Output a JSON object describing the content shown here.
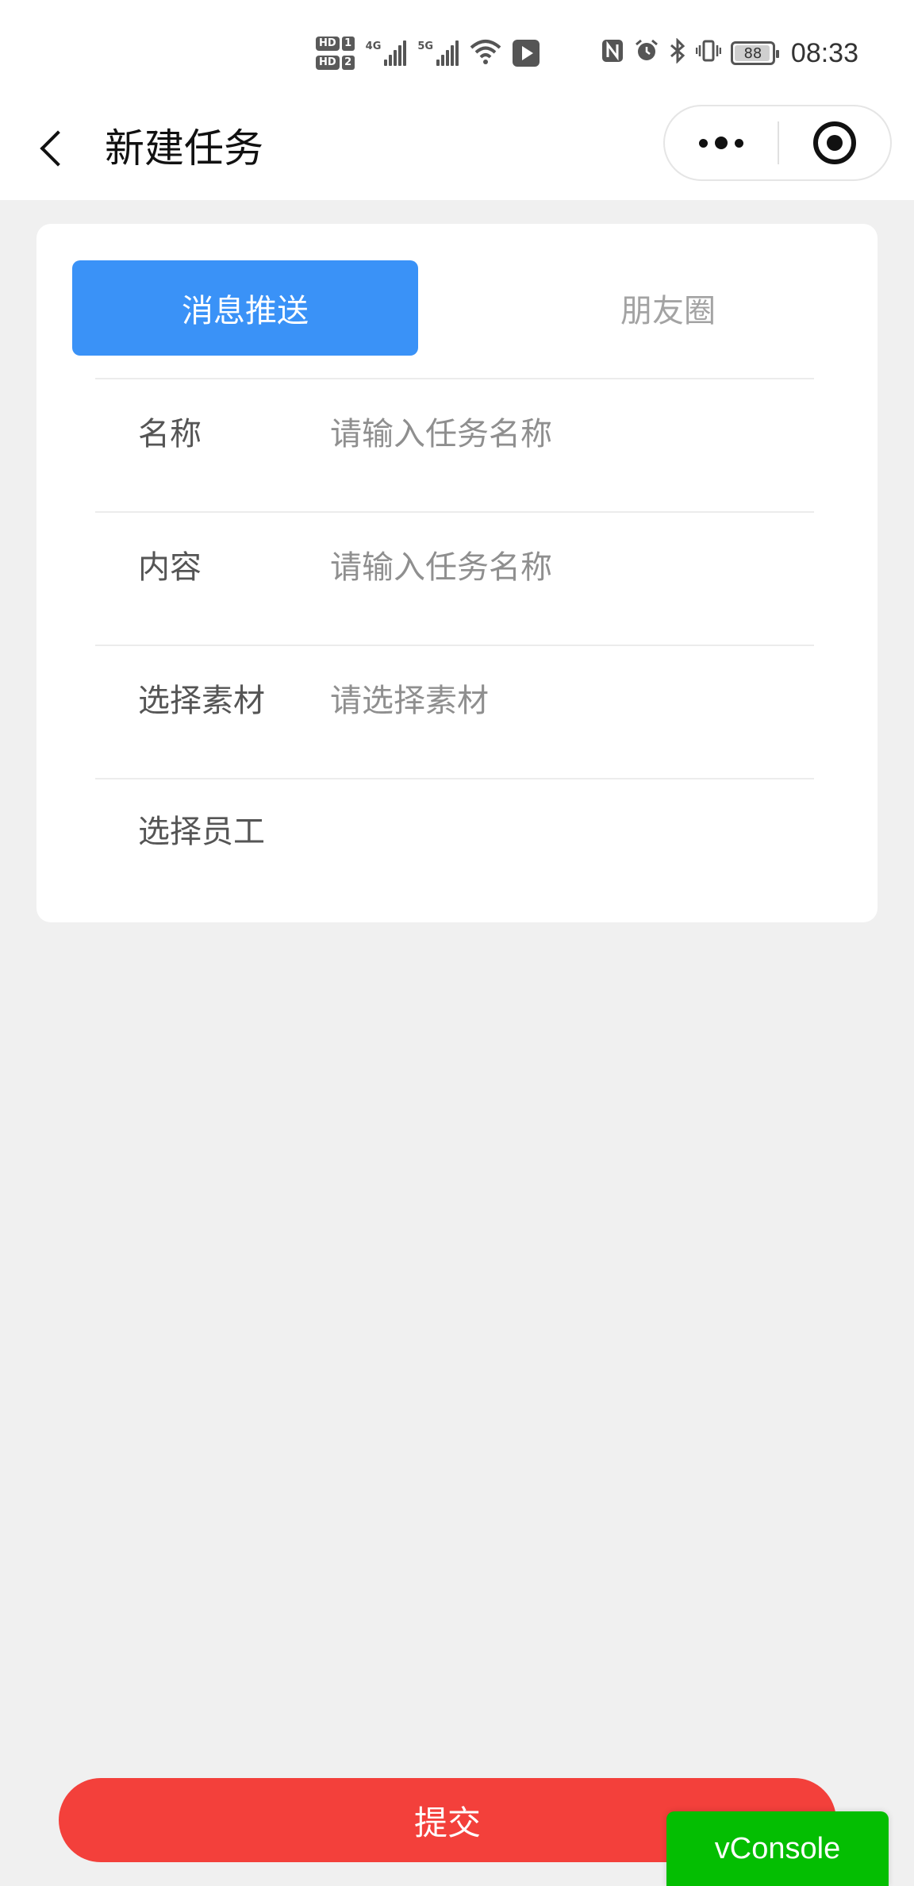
{
  "status_bar": {
    "hd1": "HD",
    "hd1_num": "1",
    "hd2": "HD",
    "hd2_num": "2",
    "net1": "4G",
    "net2": "5G",
    "battery": "88",
    "time": "08:33",
    "icons": [
      "hd-icon",
      "signal-4g-icon",
      "signal-5g-icon",
      "wifi-icon",
      "app-notification-icon",
      "nfc-icon",
      "alarm-icon",
      "bluetooth-icon",
      "vibrate-icon",
      "battery-icon"
    ]
  },
  "nav": {
    "title": "新建任务"
  },
  "tabs": [
    {
      "label": "消息推送",
      "active": true
    },
    {
      "label": "朋友圈",
      "active": false
    }
  ],
  "form": {
    "name": {
      "label": "名称",
      "placeholder": "请输入任务名称"
    },
    "content": {
      "label": "内容",
      "placeholder": "请输入任务名称"
    },
    "material": {
      "label": "选择素材",
      "placeholder": "请选择素材"
    },
    "staff": {
      "label": "选择员工"
    }
  },
  "submit_label": "提交",
  "vconsole_label": "vConsole",
  "colors": {
    "primary_blue": "#3a92f7",
    "submit_red": "#f3403b",
    "vconsole_green": "#04be02",
    "page_bg": "#f0f0f0"
  }
}
